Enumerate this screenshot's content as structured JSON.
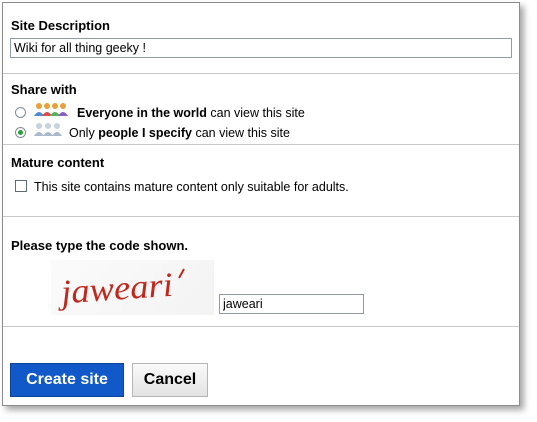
{
  "site_description": {
    "label": "Site Description",
    "value": "Wiki for all thing geeky !"
  },
  "share": {
    "label": "Share with",
    "options": [
      {
        "bold": "Everyone in the world",
        "suffix": " can view this site",
        "prefix": "",
        "icon": "people-group-color-icon",
        "selected": false
      },
      {
        "prefix": "Only ",
        "bold": "people I specify",
        "suffix": " can view this site",
        "icon": "people-group-gray-icon",
        "selected": true
      }
    ]
  },
  "mature": {
    "label": "Mature content",
    "checkbox_label": "This site contains mature content only suitable for adults.",
    "checked": false
  },
  "captcha": {
    "label": "Please type the code shown.",
    "image_text": "jaweari",
    "value": "jaweari"
  },
  "buttons": {
    "create": "Create site",
    "cancel": "Cancel"
  },
  "colors": {
    "primary_button": "#1159c8",
    "radio_selected": "#2e9f3e",
    "captcha_ink": "#c0281e"
  }
}
